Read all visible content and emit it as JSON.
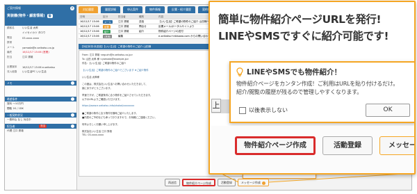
{
  "left_panel": {
    "header_small": "ご案内情報",
    "header_title": "実装機(物件・顧客情報)",
    "header_pill": "管",
    "fields": [
      {
        "k": "顧客名",
        "v": "いい生活 太郎",
        "red": false
      },
      {
        "k": "",
        "v": "イイセイカツ タロウ",
        "red": false
      },
      {
        "k": "電話",
        "v": "03-xxxx-xxxx",
        "red": false
      },
      {
        "k": "携帯",
        "v": "",
        "red": false
      },
      {
        "k": "メール",
        "v": "yamada@e-seikatsu.co.jp",
        "red": false
      },
      {
        "k": "最終",
        "v": "16/12/17 15:06 (営業)",
        "red": true
      },
      {
        "k": "担当",
        "v": "江口 秀雄",
        "red": false
      },
      {
        "k": "",
        "v": "",
        "red": false
      },
      {
        "k": "反響媒体",
        "v": "16/12/17 15:06 e-seikatsu",
        "red": false
      },
      {
        "k": "流入経路",
        "v": "いい生活PC いい生活",
        "red": false
      },
      {
        "k": "",
        "v": "",
        "red": false
      }
    ],
    "sections": [
      {
        "label": "メモ",
        "chip": "",
        "rows": [
          "",
          ""
        ]
      },
      {
        "label": "希望条件",
        "chip": "",
        "rows": [
          "賃料  ～10万円",
          "間取  1K / 1DK"
        ]
      },
      {
        "label": "一般契約状況",
        "chip": "",
        "rows": [
          "一般申込 なし  対応中"
        ]
      },
      {
        "label": "担当者",
        "chip": "担当",
        "rows": [
          "代理 江口 秀雄"
        ]
      }
    ]
  },
  "tabs": [
    "対応履歴",
    "履歴詳細",
    "申込案件",
    "物件情報",
    "反響・紹介履歴",
    "契約情報",
    "その他"
  ],
  "table": {
    "header": [
      "日時",
      "区分",
      "担当者",
      "種別",
      "内容"
    ],
    "rows": [
      {
        "date": "16/12/17 15:06",
        "badge": "メール",
        "badge_color": "#2f6fa6",
        "staff": "江口 秀雄",
        "kind": "送信",
        "text": "【いい生活】ご希望の物件のご紹介 山田様への物件紹介メール"
      },
      {
        "date": "16/12/17 15:06",
        "badge": "反響",
        "badge_color": "#f0a130",
        "staff": "江口 秀雄",
        "kind": "問合せ",
        "text": "反響メール/ポータルサイトより"
      },
      {
        "date": "16/12/17 15:06",
        "badge": "紹介",
        "badge_color": "#3aa05a",
        "staff": "江口 秀雄",
        "kind": "紹介",
        "text": "物件紹介ページの送付"
      },
      {
        "date": "16/12/17 15:06",
        "badge": "(其他)",
        "badge_color": "#888888",
        "staff": "編集",
        "kind": "",
        "text": "e-seikatsu+ebisawa.com からの問い合わせ"
      }
    ]
  },
  "detail_bar": "【対応状況:未送信】【いい生活】ご希望の物件のご紹介 山田様",
  "message_lines": [
    {
      "t": "From: 江口 秀雄 <eguchi@e-seikatsu.co.jp>",
      "blue": false
    },
    {
      "t": "To: 山田 太郎 様 <yamada@example.jp>",
      "blue": false
    },
    {
      "t": "件名: 【いい生活】ご希望の物件のご紹介",
      "blue": false
    },
    {
      "t": "",
      "blue": false
    },
    {
      "t": "【いい生活】ご希望の物件のご紹介でございます ★ご紹介物件",
      "blue": true
    },
    {
      "t": "",
      "blue": false
    },
    {
      "t": "いい生活 太郎様",
      "blue": false
    },
    {
      "t": "",
      "blue": false
    },
    {
      "t": "この度は、株式会社いい生活へお問い合わせいただきまして、",
      "blue": false
    },
    {
      "t": "誠にありがとうございます。",
      "blue": false
    },
    {
      "t": "",
      "blue": false
    },
    {
      "t": "早速ですが、ご希望条件に合う物件をご紹介させていただきます。",
      "blue": false
    },
    {
      "t": "以下のURLよりご確認いただけます。",
      "blue": false
    },
    {
      "t": "",
      "blue": false
    },
    {
      "t": "https://www.e-seikatsu.info/shokai/xxxxxxxx",
      "blue": true
    },
    {
      "t": "",
      "blue": false
    },
    {
      "t": "■ご希望の条件に合う物件を随時ご紹介いたします。",
      "blue": false
    },
    {
      "t": "■内見のご予約なども承っておりますので、お気軽にご連絡ください。",
      "blue": false
    },
    {
      "t": "",
      "blue": false
    },
    {
      "t": "何卒よろしくお願い申し上げます。",
      "blue": false
    },
    {
      "t": "",
      "blue": false
    },
    {
      "t": "株式会社いい生活 江口 秀雄",
      "blue": false
    },
    {
      "t": "TEL: 03-xxxx-xxxx",
      "blue": false
    }
  ],
  "bottom_buttons": {
    "save": "再送信",
    "property": "物件紹介ページ作成",
    "activity": "活動登録",
    "message": "メッセージ作成"
  },
  "tiny_popup": {
    "title": "LINEやSMSでも物件紹介！",
    "body": "物件紹介ページをカンタン作成！ご利用はURLを貼り付けるだけ。紹介/閲覧の履歴が残るので管理しやすくなります。",
    "checkbox": "以後表示しない",
    "ok": "OK"
  },
  "callout": {
    "headline_1": "簡単に物件紹介ページURLを発行!",
    "headline_2": "LINEやSMSですぐに紹介可能です!",
    "left_fragment": "上",
    "popup_title": "LINEやSMSでも物件紹介！",
    "popup_body_1": "物件紹介ページをカンタン作成！ご利用はURLを貼り付けるだけ。",
    "popup_body_2": "紹介/閲覧の履歴が残るので管理しやすくなります。",
    "checkbox_label": "以後表示しない",
    "ok_label": "OK",
    "btn_property": "物件紹介ページ作成",
    "btn_activity": "活動登録",
    "btn_message": "メッセージ作成"
  },
  "colors": {
    "accent_orange": "#f5a623",
    "highlight_red": "#d92b2b",
    "primary_blue": "#2f6fa6"
  }
}
